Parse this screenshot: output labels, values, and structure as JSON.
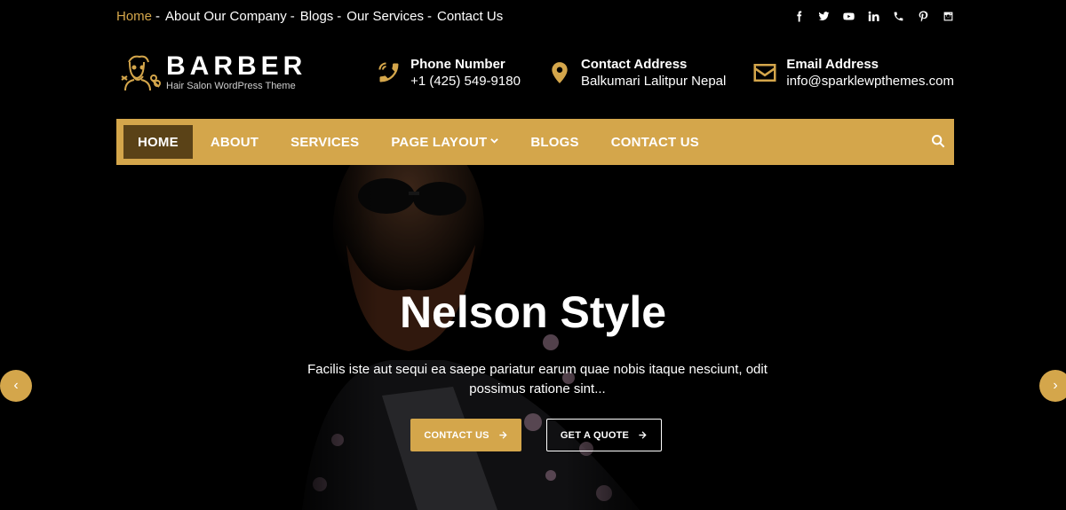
{
  "topbar": {
    "links": [
      {
        "label": "Home",
        "sep": "-"
      },
      {
        "label": "About Our Company",
        "sep": "-"
      },
      {
        "label": "Blogs",
        "sep": "-"
      },
      {
        "label": "Our Services",
        "sep": "-"
      },
      {
        "label": "Contact Us",
        "sep": ""
      }
    ],
    "socials": [
      "facebook-icon",
      "twitter-icon",
      "youtube-icon",
      "linkedin-icon",
      "phone-icon",
      "pinterest-icon",
      "instagram-icon"
    ]
  },
  "header": {
    "brand": "BARBER",
    "tagline": "Hair Salon WordPress Theme",
    "contacts": [
      {
        "title": "Phone Number",
        "value": "+1 (425) 549-9180",
        "icon": "phone-icon"
      },
      {
        "title": "Contact Address",
        "value": "Balkumari Lalitpur Nepal",
        "icon": "map-pin-icon"
      },
      {
        "title": "Email Address",
        "value": "info@sparklewpthemes.com",
        "icon": "envelope-icon"
      }
    ]
  },
  "nav": {
    "items": [
      {
        "label": "HOME"
      },
      {
        "label": "ABOUT"
      },
      {
        "label": "SERVICES"
      },
      {
        "label": "PAGE LAYOUT"
      },
      {
        "label": "BLOGS"
      },
      {
        "label": "CONTACT US"
      }
    ]
  },
  "hero": {
    "title": "Nelson Style",
    "description": "Facilis iste aut sequi ea saepe pariatur earum quae nobis itaque nesciunt, odit possimus ratione sint...",
    "primary_button": "CONTACT US",
    "secondary_button": "GET A QUOTE",
    "prev_arrow": "‹",
    "next_arrow": "›"
  },
  "colors": {
    "accent": "#d4a64b",
    "nav_active": "#5a4217",
    "background": "#000000"
  }
}
